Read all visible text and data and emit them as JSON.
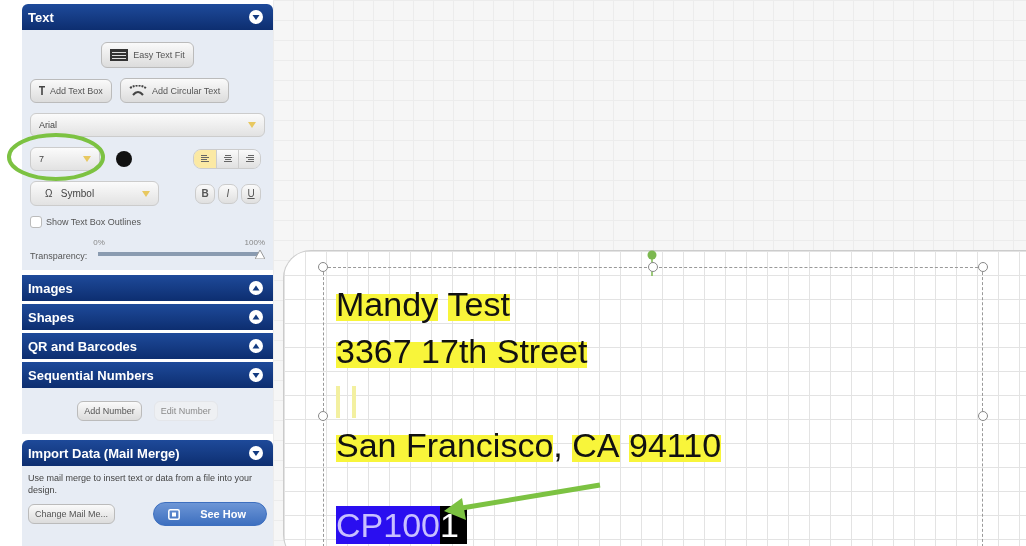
{
  "panel": {
    "sections": [
      {
        "kind": "text",
        "title": "Text",
        "expanded": true
      },
      {
        "kind": "plain",
        "title": "Images",
        "expanded": false
      },
      {
        "kind": "plain",
        "title": "Shapes",
        "expanded": false
      },
      {
        "kind": "plain",
        "title": "QR and Barcodes",
        "expanded": false
      },
      {
        "kind": "numbers",
        "title": "Sequential Numbers",
        "expanded": true
      },
      {
        "kind": "import",
        "title": "Import Data (Mail Merge)",
        "expanded": true
      }
    ]
  },
  "text_tools": {
    "easy_fit": "Easy Text Fit",
    "add_text_box": "Add Text Box",
    "add_circular_text": "Add Circular Text",
    "font": "Arial",
    "size": "7",
    "align": [
      {
        "kind": "left",
        "selected": true
      },
      {
        "kind": "center",
        "selected": false
      },
      {
        "kind": "right",
        "selected": false
      }
    ],
    "styles": [
      {
        "label": "B",
        "selected": false
      },
      {
        "label": "I",
        "selected": false
      },
      {
        "label": "U",
        "selected": false
      }
    ],
    "symbol": "Symbol",
    "symbol_glyph": "Ω",
    "outline": {
      "label": "Show Text Box Outlines",
      "checked": false
    },
    "transparency": {
      "label": "Transparency:",
      "min": "0%",
      "max": "100%",
      "level": 1.0
    }
  },
  "numbers": {
    "buttons": [
      {
        "label": "Add Number",
        "disabled": false
      },
      {
        "label": "Edit Number",
        "disabled": true
      }
    ]
  },
  "import": {
    "description": "Use mail merge to insert text or data from a file into your design.",
    "buttons": [
      {
        "kind": "plain",
        "label": "Change Mail Me..."
      },
      {
        "kind": "primary",
        "label": "See How"
      }
    ]
  },
  "label": {
    "lines": [
      {
        "kind": "text",
        "segments": [
          {
            "text": "Mandy",
            "highlight": true
          },
          {
            "text": "Test",
            "highlight": true
          }
        ]
      },
      {
        "kind": "text",
        "segments": [
          {
            "text": "3367 17th Street",
            "highlight": true
          }
        ]
      },
      {
        "kind": "cursors"
      },
      {
        "kind": "text",
        "segments": [
          {
            "text": "San Francisco",
            "highlight": true
          },
          {
            "text": ",",
            "highlight": false
          },
          {
            "text": "CA",
            "highlight": true
          },
          {
            "text": "94110",
            "highlight": true
          }
        ]
      },
      {
        "kind": "gap"
      },
      {
        "kind": "selection",
        "segments": [
          {
            "text": "CP100",
            "selected": true
          },
          {
            "text": "1",
            "selected": false
          }
        ]
      }
    ]
  }
}
